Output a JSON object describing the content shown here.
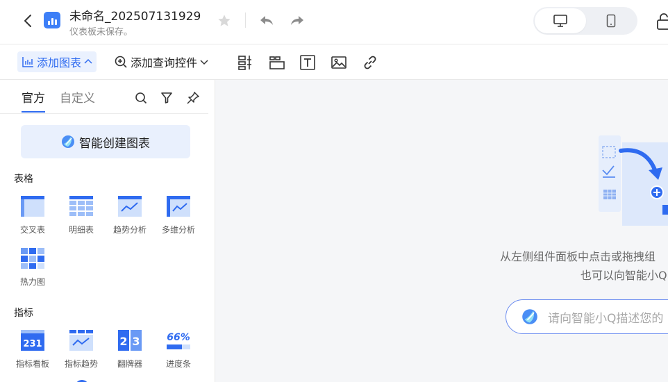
{
  "header": {
    "title": "未命名_202507131929",
    "subtitle": "仪表板未保存。"
  },
  "toolbar": {
    "add_chart": "添加图表",
    "add_query": "添加查询控件"
  },
  "sidebar": {
    "tabs": [
      "官方",
      "自定义"
    ],
    "ai_create": "智能创建图表",
    "sections": [
      {
        "title": "表格",
        "items": [
          "交叉表",
          "明细表",
          "趋势分析",
          "多维分析",
          "热力图"
        ]
      },
      {
        "title": "指标",
        "items": [
          "指标看板",
          "指标趋势",
          "翻牌器",
          "进度条"
        ]
      }
    ],
    "thumb_text": {
      "kanban": "231",
      "flip_a": "2",
      "flip_b": "3",
      "progress": "66%"
    }
  },
  "canvas": {
    "hint_line1": "从左侧组件面板中点击或拖拽组",
    "hint_line2": "也可以向智能小Q",
    "ai_placeholder": "请向智能小Q描述您的"
  },
  "colors": {
    "accent": "#2f6bf0",
    "accent_light": "#e9f0fd",
    "canvas_bg": "#f5f6f8"
  }
}
